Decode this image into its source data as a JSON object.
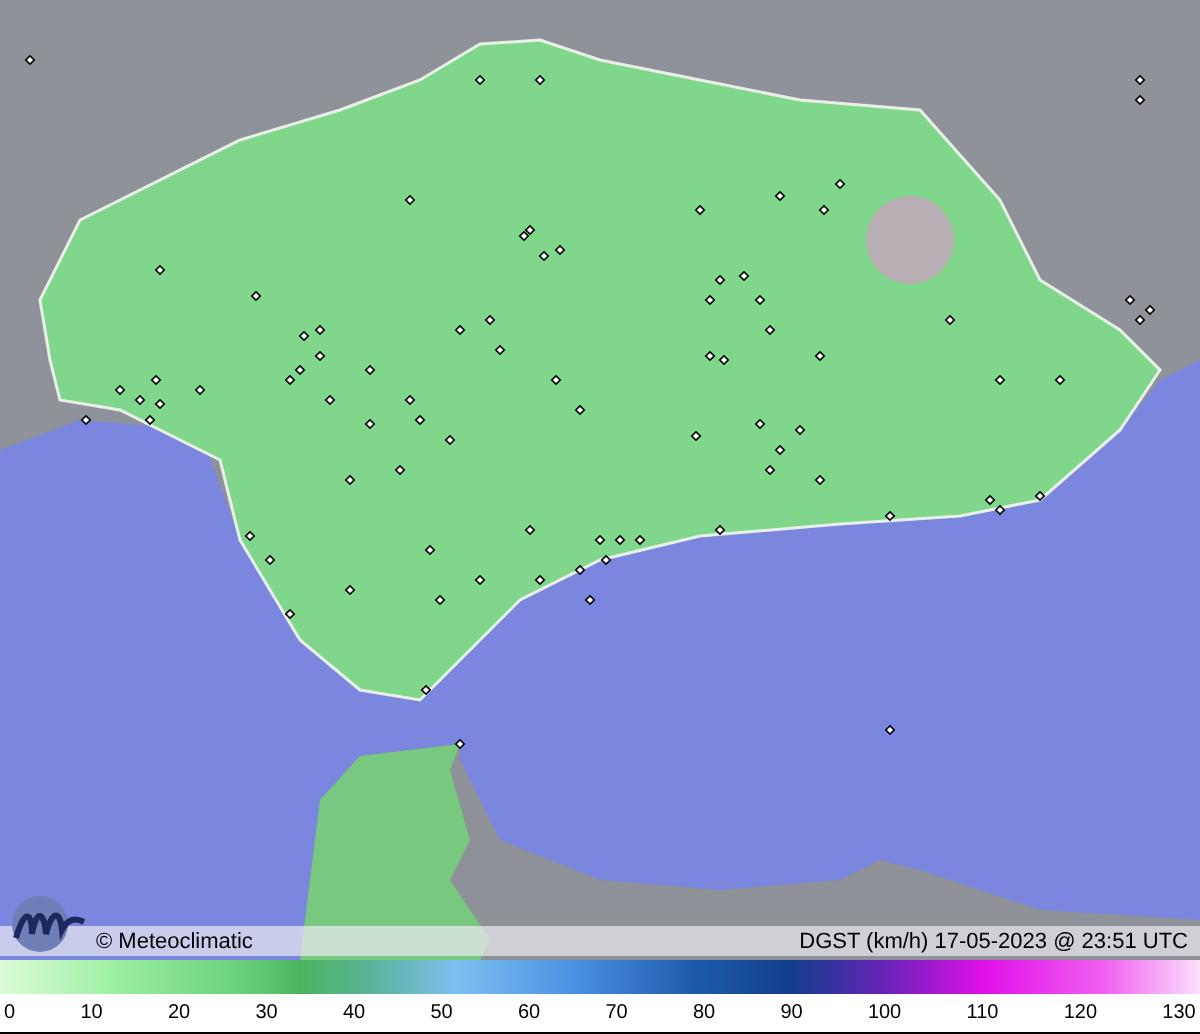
{
  "map": {
    "brand": "© Meteoclimatic",
    "caption": "DGST (km/h)  17-05-2023 @ 23:51 UTC"
  },
  "legend": {
    "ticks": [
      "0",
      "10",
      "20",
      "30",
      "40",
      "50",
      "60",
      "70",
      "80",
      "90",
      "100",
      "110",
      "120",
      "130"
    ]
  }
}
